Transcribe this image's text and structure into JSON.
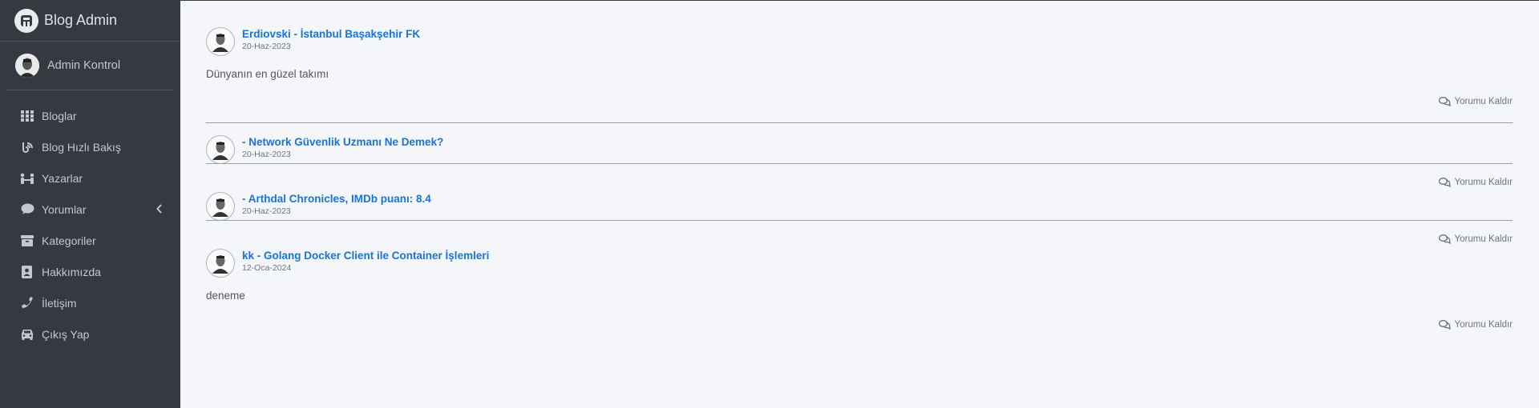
{
  "brand": {
    "name": "Blog Admin"
  },
  "user": {
    "name": "Admin Kontrol"
  },
  "sidebar": {
    "items": [
      {
        "label": "Bloglar",
        "icon": "grid-icon"
      },
      {
        "label": "Blog Hızlı Bakış",
        "icon": "blog-icon"
      },
      {
        "label": "Yazarlar",
        "icon": "users-icon"
      },
      {
        "label": "Yorumlar",
        "icon": "comment-icon"
      },
      {
        "label": "Kategoriler",
        "icon": "box-icon"
      },
      {
        "label": "Hakkımızda",
        "icon": "contact-card-icon"
      },
      {
        "label": "İletişim",
        "icon": "phone-icon"
      },
      {
        "label": "Çıkış Yap",
        "icon": "car-icon"
      }
    ]
  },
  "comments": [
    {
      "title": "Erdiovski - İstanbul Başakşehir FK",
      "date": "20-Haz-2023",
      "body": "Dünyanın en güzel takımı",
      "remove_label": "Yorumu Kaldır"
    },
    {
      "title": "- Network Güvenlik Uzmanı Ne Demek?",
      "date": "20-Haz-2023",
      "body": "",
      "remove_label": "Yorumu Kaldır"
    },
    {
      "title": "- Arthdal Chronicles, IMDb puanı: 8.4",
      "date": "20-Haz-2023",
      "body": "",
      "remove_label": "Yorumu Kaldır"
    },
    {
      "title": "kk - Golang Docker Client ile Container İşlemleri",
      "date": "12-Oca-2024",
      "body": "deneme",
      "remove_label": "Yorumu Kaldır"
    }
  ],
  "colors": {
    "sidebar_bg": "#343a40",
    "link": "#1a73d9",
    "page_bg": "#f4f6f9"
  }
}
